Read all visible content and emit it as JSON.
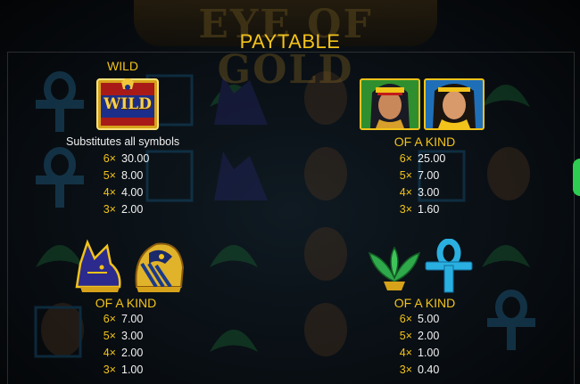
{
  "title": "PAYTABLE",
  "logo_text": "EYE OF GOLD",
  "wild": {
    "label": "WILD",
    "symbol_text": "WILD",
    "description": "Substitutes all symbols",
    "payouts": [
      {
        "count": "6×",
        "value": "30.00"
      },
      {
        "count": "5×",
        "value": "8.00"
      },
      {
        "count": "4×",
        "value": "4.00"
      },
      {
        "count": "3×",
        "value": "2.00"
      }
    ]
  },
  "queens": {
    "label": "OF A KIND",
    "icons": [
      "cleopatra-icon",
      "queen-icon"
    ],
    "payouts": [
      {
        "count": "6×",
        "value": "25.00"
      },
      {
        "count": "5×",
        "value": "7.00"
      },
      {
        "count": "4×",
        "value": "3.00"
      },
      {
        "count": "3×",
        "value": "1.60"
      }
    ]
  },
  "animals": {
    "label": "OF A KIND",
    "icons": [
      "anubis-icon",
      "horus-icon"
    ],
    "payouts": [
      {
        "count": "6×",
        "value": "7.00"
      },
      {
        "count": "5×",
        "value": "3.00"
      },
      {
        "count": "4×",
        "value": "2.00"
      },
      {
        "count": "3×",
        "value": "1.00"
      }
    ]
  },
  "relics": {
    "label": "OF A KIND",
    "icons": [
      "lotus-icon",
      "ankh-icon"
    ],
    "payouts": [
      {
        "count": "6×",
        "value": "5.00"
      },
      {
        "count": "5×",
        "value": "2.00"
      },
      {
        "count": "4×",
        "value": "1.00"
      },
      {
        "count": "3×",
        "value": "0.40"
      }
    ]
  },
  "colors": {
    "gold": "#f2c31a",
    "background": "#070b0f",
    "side_tab": "#2fcc52"
  }
}
